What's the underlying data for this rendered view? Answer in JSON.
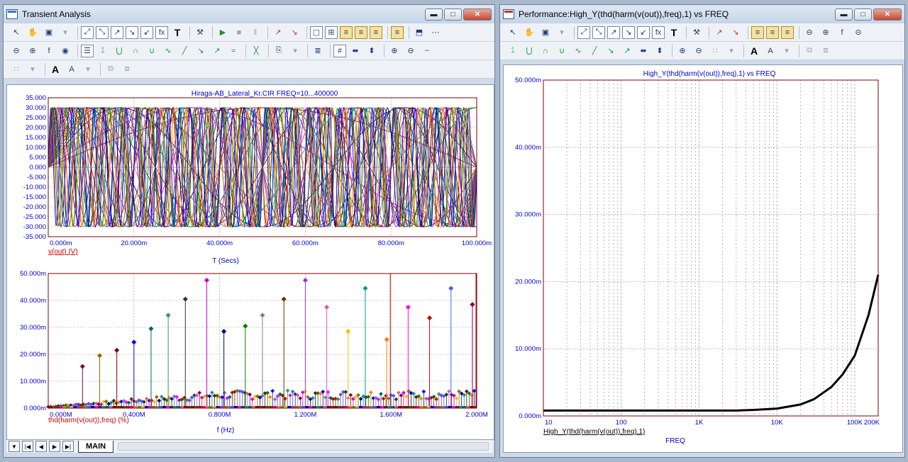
{
  "left_window": {
    "title": "Transient Analysis",
    "toolbar_rows": [
      [
        "pointer-icon",
        "pan-icon",
        "graph-icon",
        "dropdown-icon",
        "scale-icon",
        "zoom-box-icon",
        "cursor-icon",
        "tangent-icon",
        "peak-icon",
        "fx-icon",
        "text-tool-icon",
        "tool-icon",
        "run-icon",
        "stop-icon",
        "pause-icon",
        "red-marker-icon",
        "red-marker2-icon",
        "frame-icon",
        "grid-icon",
        "table1-icon",
        "table2-icon",
        "table3-icon",
        "table4-icon",
        "split-icon",
        "dots-icon"
      ],
      [
        "zoom-out-icon",
        "zoom-in-icon",
        "fx-zoom-icon",
        "circle-icon",
        "properties-icon",
        "peak-find-icon",
        "valley-icon",
        "high-icon",
        "low-icon",
        "inflect-icon",
        "slope-icon",
        "min-icon",
        "max-icon",
        "avg-icon",
        "cross-icon",
        "clipboard-icon",
        "dropdown-icon",
        "doc-icon",
        "count-icon",
        "fit-icon",
        "fit2-icon",
        "magnify-icon",
        "demagnify-icon",
        "ruler-icon"
      ],
      [
        "grid-dots-icon",
        "dropdown-icon",
        "font-icon",
        "color-icon",
        "dropdown-icon",
        "stack-icon",
        "unstack-icon"
      ]
    ],
    "tab_label": "MAIN",
    "plot1": {
      "title": "Hiraga-AB_Lateral_Kr.CIR FREQ=10...400000",
      "y_ticks": [
        "35.000",
        "30.000",
        "25.000",
        "20.000",
        "15.000",
        "10.000",
        "5.000",
        "0.000",
        "-5.000",
        "-10.000",
        "-15.000",
        "-20.000",
        "-25.000",
        "-30.000",
        "-35.000"
      ],
      "x_ticks": [
        "0.000m",
        "20.000m",
        "40.000m",
        "60.000m",
        "80.000m",
        "100.000m"
      ],
      "trace_label": "v(out) (V)",
      "xlabel": "T (Secs)"
    },
    "plot2": {
      "y_ticks": [
        "50.000m",
        "40.000m",
        "30.000m",
        "20.000m",
        "10.000m",
        "0.000m"
      ],
      "x_ticks": [
        "0.000M",
        "0.400M",
        "0.800M",
        "1.200M",
        "1.600M",
        "2.000M"
      ],
      "trace_label": "thd(harm(v(out)),freq) (%)",
      "xlabel": "f (Hz)"
    }
  },
  "right_window": {
    "title": "Performance:High_Y(thd(harm(v(out)),freq),1) vs FREQ",
    "toolbar_rows": [
      [
        "pointer-icon",
        "pan-icon",
        "graph-icon",
        "dropdown-icon",
        "scale-icon",
        "zoom-box-icon",
        "cursor-icon",
        "tangent-icon",
        "peak-icon",
        "fx-icon",
        "text-tool-icon",
        "tool-icon",
        "red-marker-icon",
        "red-marker2-icon",
        "table1-icon",
        "table2-icon",
        "table3-icon",
        "zoom-out-icon",
        "zoom-in-icon",
        "fx-zoom-icon",
        "minus-icon"
      ],
      [
        "peak-find-icon",
        "valley-icon",
        "high-icon",
        "low-icon",
        "inflect-icon",
        "slope-icon",
        "min-icon",
        "max-icon",
        "fit-icon",
        "fit2-icon",
        "magnify-icon",
        "demagnify-icon",
        "grid-dots-icon",
        "dropdown-icon",
        "font-icon",
        "color-icon",
        "dropdown-icon",
        "stack-icon",
        "unstack-icon"
      ]
    ],
    "chart": {
      "title": "High_Y(thd(harm(v(out)),freq),1) vs FREQ",
      "y_ticks": [
        "50.000m",
        "40.000m",
        "30.000m",
        "20.000m",
        "10.000m",
        "0.000m"
      ],
      "x_ticks": [
        "10",
        "100",
        "1K",
        "10K",
        "100K",
        "200K"
      ],
      "trace_label": "High_Y(thd(harm(v(out)),freq),1)",
      "xlabel": "FREQ"
    }
  },
  "chart_data": [
    {
      "type": "line",
      "title": "Hiraga-AB_Lateral_Kr.CIR FREQ=10...400000",
      "xlabel": "T (Secs)",
      "ylabel": "v(out) (V)",
      "xlim": [
        0,
        0.1
      ],
      "ylim": [
        -35,
        35
      ],
      "amplitude": 30,
      "frequencies_hz": [
        5,
        7.5,
        10,
        12.5,
        15,
        17.5,
        20,
        22.5,
        25,
        27.5,
        30,
        35,
        40,
        45,
        50,
        55,
        60,
        70,
        80,
        90,
        100,
        120,
        140,
        160,
        180,
        200,
        250,
        300,
        350,
        400
      ],
      "grid": true
    },
    {
      "type": "scatter",
      "xlabel": "f (Hz)",
      "ylabel": "thd(harm(v(out)),freq) (%)",
      "xlim": [
        0,
        2000000
      ],
      "ylim": [
        0,
        0.05
      ],
      "tall_stems": [
        {
          "x": 0.08,
          "y": 0.0155
        },
        {
          "x": 0.12,
          "y": 0.0195
        },
        {
          "x": 0.16,
          "y": 0.0215
        },
        {
          "x": 0.2,
          "y": 0.0245
        },
        {
          "x": 0.24,
          "y": 0.0295
        },
        {
          "x": 0.28,
          "y": 0.0345
        },
        {
          "x": 0.32,
          "y": 0.0405
        },
        {
          "x": 0.37,
          "y": 0.0475
        },
        {
          "x": 0.41,
          "y": 0.0285
        },
        {
          "x": 0.46,
          "y": 0.0305
        },
        {
          "x": 0.5,
          "y": 0.0345
        },
        {
          "x": 0.55,
          "y": 0.0405
        },
        {
          "x": 0.6,
          "y": 0.0475
        },
        {
          "x": 0.65,
          "y": 0.0375
        },
        {
          "x": 0.7,
          "y": 0.0285
        },
        {
          "x": 0.74,
          "y": 0.0445
        },
        {
          "x": 0.79,
          "y": 0.0255
        },
        {
          "x": 0.84,
          "y": 0.0375
        },
        {
          "x": 0.89,
          "y": 0.0335
        },
        {
          "x": 0.94,
          "y": 0.0445
        },
        {
          "x": 0.99,
          "y": 0.0385
        }
      ],
      "grid": true
    },
    {
      "type": "line",
      "title": "High_Y(thd(harm(v(out)),freq),1) vs FREQ",
      "xlabel": "FREQ",
      "ylabel": "High_Y(thd(harm(v(out)),freq),1)",
      "x_scale": "log",
      "xlim": [
        10,
        200000
      ],
      "ylim": [
        0,
        0.05
      ],
      "x": [
        10,
        100,
        1000,
        3000,
        5000,
        10000,
        20000,
        30000,
        50000,
        70000,
        100000,
        150000,
        200000
      ],
      "y": [
        0.0008,
        0.0008,
        0.0008,
        0.0008,
        0.0009,
        0.0011,
        0.0017,
        0.0025,
        0.0043,
        0.0062,
        0.009,
        0.015,
        0.021
      ],
      "grid": true
    }
  ],
  "colors": {
    "axis_blue": "#0000cc",
    "label_red": "#cc0000",
    "plot_border": "#800000",
    "grid_gray": "#888888"
  }
}
